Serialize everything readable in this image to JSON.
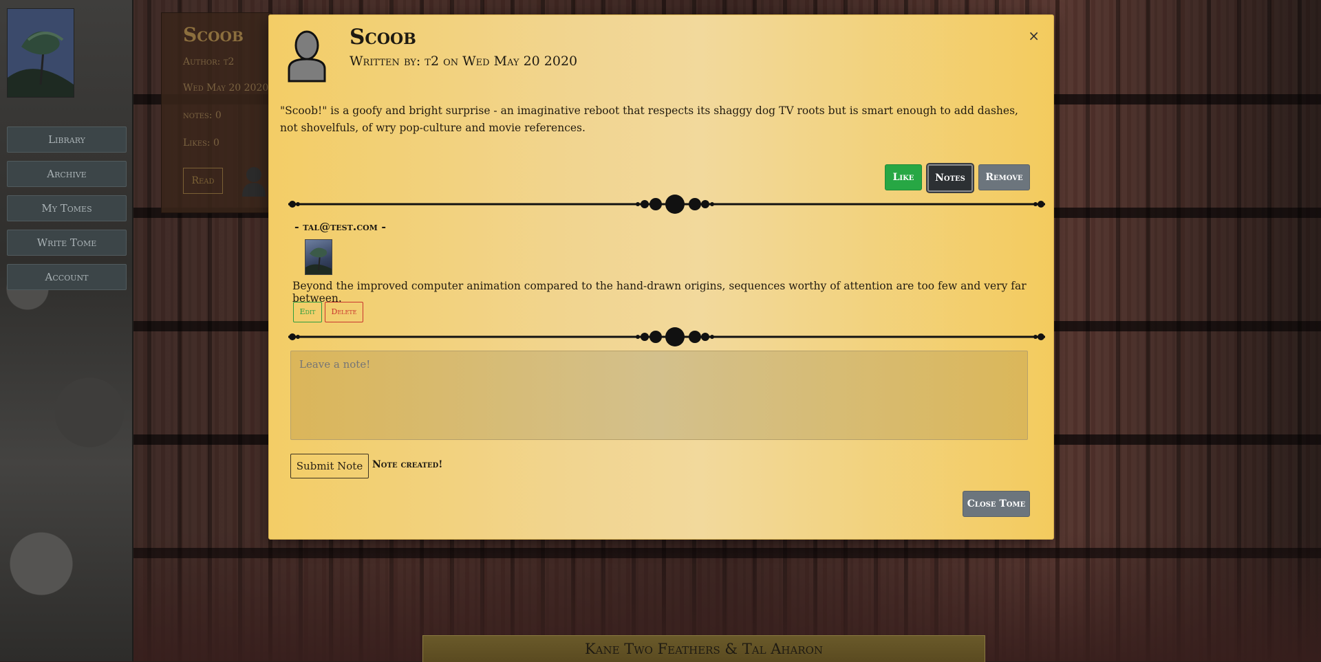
{
  "sidebar": {
    "items": [
      {
        "label": "Library"
      },
      {
        "label": "Archive"
      },
      {
        "label": "My Tomes"
      },
      {
        "label": "Write Tome"
      },
      {
        "label": "Account"
      }
    ]
  },
  "card": {
    "title": "Scoob",
    "author": "Author: t2",
    "date": "Wed May 20 2020",
    "notes": "notes: 0",
    "likes": "Likes: 0",
    "read_label": "Read"
  },
  "modal": {
    "close_glyph": "×",
    "title": "Scoob",
    "byline": "Written by: t2 on Wed May 20 2020",
    "body": "\"Scoob!\" is a goofy and bright surprise - an imaginative reboot that respects its shaggy dog TV roots but is smart enough to add dashes, not shovelfuls, of wry pop-culture and movie references.",
    "actions": {
      "like": "Like",
      "notes": "Notes",
      "remove": "Remove"
    },
    "note": {
      "author": "- tal@test.com -",
      "text": "Beyond the improved computer animation compared to the hand-drawn origins, sequences worthy of attention are too few and very far between.",
      "edit": "Edit",
      "delete": "Delete"
    },
    "input": {
      "placeholder": "Leave a note!"
    },
    "submit_label": "Submit Note",
    "status": "Note created!",
    "close_tome": "Close Tome"
  },
  "footer": {
    "credits": "Kane Two Feathers & Tal Aharon"
  },
  "colors": {
    "modal_gold": "#f3cd66",
    "like_green": "#27a744",
    "notes_dark": "#2c3033",
    "remove_gray": "#6c757d",
    "delete_red": "#c8342d"
  }
}
